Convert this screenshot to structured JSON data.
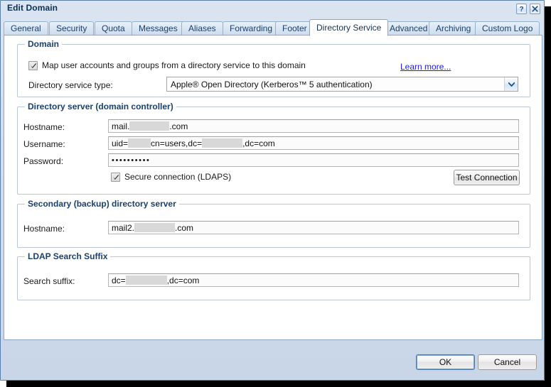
{
  "window": {
    "title": "Edit Domain",
    "help_button": "?",
    "close_button": "✕"
  },
  "tabs": [
    {
      "label": "General",
      "active": false
    },
    {
      "label": "Security",
      "active": false
    },
    {
      "label": "Quota",
      "active": false
    },
    {
      "label": "Messages",
      "active": false
    },
    {
      "label": "Aliases",
      "active": false
    },
    {
      "label": "Forwarding",
      "active": false
    },
    {
      "label": "Footer",
      "active": false
    },
    {
      "label": "Directory Service",
      "active": true
    },
    {
      "label": "Advanced",
      "active": false
    },
    {
      "label": "Archiving",
      "active": false
    },
    {
      "label": "Custom Logo",
      "active": false
    }
  ],
  "domain_group": {
    "legend": "Domain",
    "map_checkbox_label": "Map user accounts and groups from a directory service to this domain",
    "map_checkbox_checked": true,
    "learn_more_label": "Learn more...",
    "service_type_label": "Directory service type:",
    "service_type_value": "Apple® Open Directory (Kerberos™ 5 authentication)"
  },
  "directory_server_group": {
    "legend": "Directory server (domain controller)",
    "hostname_label": "Hostname:",
    "hostname_prefix": "mail.",
    "hostname_suffix": ".com",
    "username_label": "Username:",
    "username_part1": "uid=",
    "username_part2": "cn=users,dc=",
    "username_part3": ",dc=com",
    "password_label": "Password:",
    "password_value": "••••••••••",
    "secure_checkbox_label": "Secure connection (LDAPS)",
    "secure_checkbox_checked": true,
    "test_connection_label": "Test Connection"
  },
  "secondary_server_group": {
    "legend": "Secondary (backup) directory server",
    "hostname_label": "Hostname:",
    "hostname_prefix": "mail2.",
    "hostname_suffix": ".com"
  },
  "ldap_suffix_group": {
    "legend": "LDAP Search Suffix",
    "search_suffix_label": "Search suffix:",
    "suffix_prefix": "dc=",
    "suffix_postfix": ",dc=com"
  },
  "footer": {
    "ok_label": "OK",
    "cancel_label": "Cancel"
  },
  "colors": {
    "title_text": "#0b3057",
    "group_legend": "#1b3f6e",
    "link": "#2020dd",
    "window_chrome": "#cfdcec",
    "panel_background": "#ffffff",
    "redaction_block": "#d8d8d8",
    "default_button_border": "#4b7bb5"
  }
}
